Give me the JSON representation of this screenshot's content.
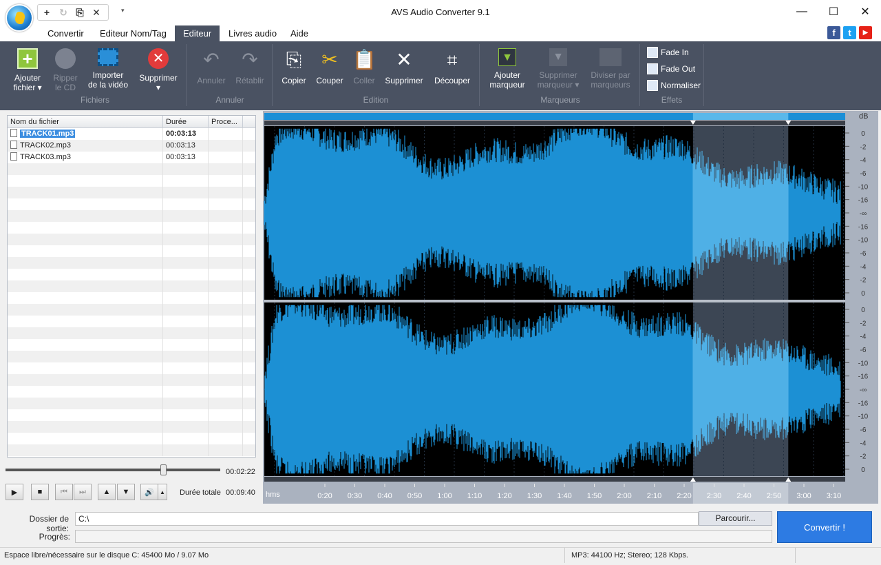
{
  "window": {
    "title": "AVS Audio Converter  9.1",
    "minimize": "—",
    "maximize": "☐",
    "close": "✕"
  },
  "quick_access": {
    "add": "+",
    "refresh": "↻",
    "paste": "⎘",
    "close": "✕",
    "dropdown": "▾"
  },
  "menu": [
    "Convertir",
    "Editeur Nom/Tag",
    "Editeur",
    "Livres audio",
    "Aide"
  ],
  "social": {
    "facebook": "f",
    "twitter": "t",
    "youtube": "▶"
  },
  "ribbon": {
    "groups": {
      "fichiers": "Fichiers",
      "annuler": "Annuler",
      "edition": "Edition",
      "marqueurs": "Marqueurs",
      "effets": "Effets"
    },
    "buttons": {
      "ajouter": "Ajouter\nfichier ▾",
      "ripper": "Ripper\nle CD",
      "importer": "Importer\nde la vidéo",
      "supprimer_file": "Supprimer\n▾",
      "annuler": "Annuler",
      "retablir": "Rétablir",
      "copier": "Copier",
      "couper": "Couper",
      "coller": "Coller",
      "supprimer": "Supprimer",
      "decouper": "Découper",
      "ajouter_marqueur": "Ajouter\nmarqueur",
      "supprimer_marqueur": "Supprimer\nmarqueur ▾",
      "diviser": "Diviser par\nmarqueurs",
      "fade_in": "Fade In",
      "fade_out": "Fade Out",
      "normaliser": "Normaliser"
    }
  },
  "file_list": {
    "columns": [
      "Nom du fichier",
      "Durée",
      "Proce..."
    ],
    "rows": [
      {
        "name": "TRACK01.mp3",
        "duration": "00:03:13",
        "selected": true
      },
      {
        "name": "TRACK02.mp3",
        "duration": "00:03:13",
        "selected": false
      },
      {
        "name": "TRACK03.mp3",
        "duration": "00:03:13",
        "selected": false
      }
    ]
  },
  "player": {
    "position": "00:02:22",
    "position_fraction": 0.735,
    "total_label": "Durée totale",
    "total": "00:09:40",
    "buttons": {
      "play": "▶",
      "stop": "■",
      "prev": "⏮",
      "next": "⏭",
      "up": "▲",
      "down": "▼",
      "volume": "🔊",
      "vol_arrow": "▲"
    }
  },
  "waveform": {
    "db_label": "dB",
    "db_scale": [
      "0",
      "-2",
      "-4",
      "-6",
      "-10",
      "-16",
      "-∞",
      "-16",
      "-10",
      "-6",
      "-4",
      "-2",
      "0"
    ],
    "time_unit": "hms",
    "time_ticks": [
      "0:20",
      "0:30",
      "0:40",
      "0:50",
      "1:00",
      "1:10",
      "1:20",
      "1:30",
      "1:40",
      "1:50",
      "2:00",
      "2:10",
      "2:20",
      "2:30",
      "2:40",
      "2:50",
      "3:00",
      "3:10"
    ],
    "selection_start": 0.738,
    "selection_end": 0.902,
    "colors": {
      "wave": "#1c90d4",
      "selection_wave": "#4fb0e6",
      "background": "#000000",
      "selection_bg": "#3c4654"
    }
  },
  "output": {
    "folder_label": "Dossier de sortie:",
    "folder_value": "C:\\",
    "browse": "Parcourir...",
    "progress_label": "Progrès:",
    "convert": "Convertir !"
  },
  "status": {
    "disk": "Espace libre/nécessaire sur le disque C: 45400 Mo / 9.07 Mo",
    "format": "MP3: 44100  Hz; Stereo; 128 Kbps."
  }
}
